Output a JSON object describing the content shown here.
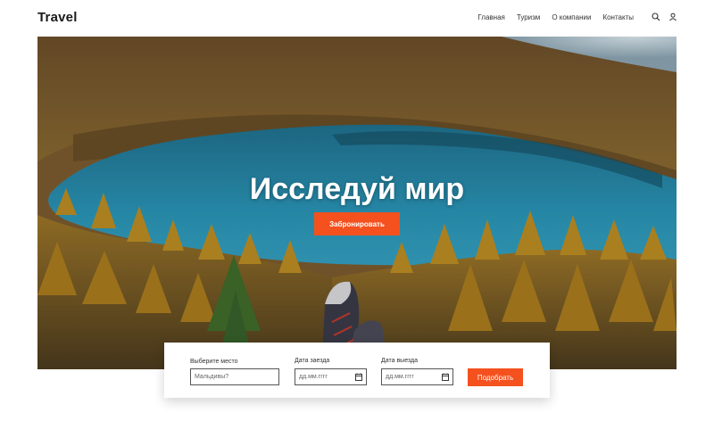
{
  "header": {
    "logo": "Travel",
    "nav": [
      {
        "label": "Главная"
      },
      {
        "label": "Туризм"
      },
      {
        "label": "О компании"
      },
      {
        "label": "Контакты"
      }
    ],
    "icons": [
      "search-icon",
      "user-icon"
    ]
  },
  "hero": {
    "title": "Исследуй мир",
    "button_label": "Забронировать"
  },
  "search": {
    "place_label": "Выберите место",
    "place_placeholder": "Мальдивы?",
    "checkin_label": "Дата заезда",
    "checkin_value": "дд.мм.гггг",
    "checkout_label": "Дата выезда",
    "checkout_value": "дд.мм.гггг",
    "submit_label": "Подобрать"
  },
  "colors": {
    "accent": "#f4511e",
    "lake": "#2a8fb0"
  }
}
